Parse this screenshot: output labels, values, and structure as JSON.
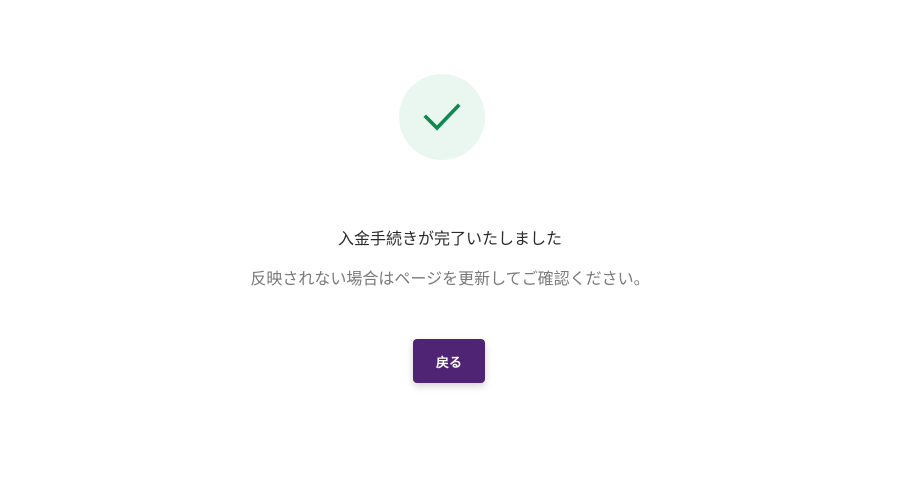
{
  "success": {
    "icon": "checkmark-icon",
    "icon_color": "#0e8a4f",
    "circle_color": "#eaf6f0"
  },
  "message": {
    "title": "入金手続きが完了いたしました",
    "subtitle": "反映されない場合はページを更新してご確認ください。"
  },
  "actions": {
    "back_label": "戻る",
    "back_color": "#4f2474"
  }
}
